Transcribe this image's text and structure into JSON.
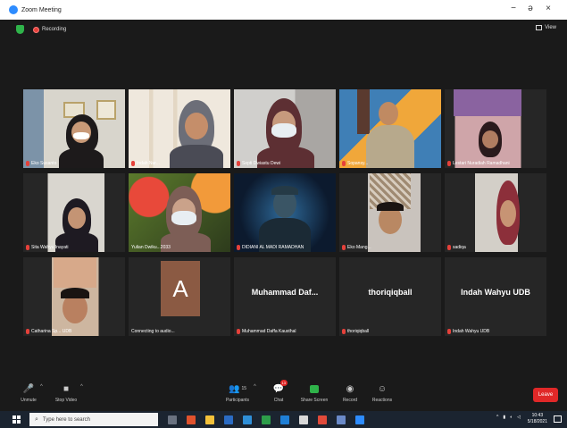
{
  "window": {
    "title": "Zoom Meeting",
    "min": "−",
    "max": "ǝ",
    "close": "×"
  },
  "infobar": {
    "recording": "Recording",
    "view": "View"
  },
  "participants": [
    {
      "name": "Eko Susanto"
    },
    {
      "name": "Indah Nur..."
    },
    {
      "name": "Septi Dwiastu Dewi"
    },
    {
      "name": "Sopansy..."
    },
    {
      "name": "Lestari Nuradiah Ramadhani"
    },
    {
      "name": "Sita Wahyu Inayati"
    },
    {
      "name": "Yulian Dwiku...2033"
    },
    {
      "name": "DIDIANI AL MADI RAMADHAN"
    },
    {
      "name": "Eko Mang..."
    },
    {
      "name": "sadiqa"
    },
    {
      "name": "Catharina Sp... UDB"
    },
    {
      "name": "Connecting to audio..."
    },
    {
      "name": "Muhammad Daffa Kausthal",
      "display": "Muhammad Daf..."
    },
    {
      "name": "thoriqiqball",
      "display": "thoriqiqball"
    },
    {
      "name": "Indah Wahyu UDB",
      "display": "Indah Wahyu UDB"
    }
  ],
  "avatar_letter": "A",
  "toolbar": {
    "unmute": "Unmute",
    "stop_video": "Stop Video",
    "participants": "Participants",
    "participants_count": "15",
    "chat": "Chat",
    "chat_badge": "13",
    "share_screen": "Share Screen",
    "record": "Record",
    "reactions": "Reactions",
    "leave": "Leave"
  },
  "taskbar": {
    "search_placeholder": "Type here to search",
    "time": "10:43",
    "date": "5/18/2021"
  },
  "colors": {
    "accent": "#2d8cff",
    "leave": "#e02828",
    "active_speaker": "#ffe53b"
  }
}
